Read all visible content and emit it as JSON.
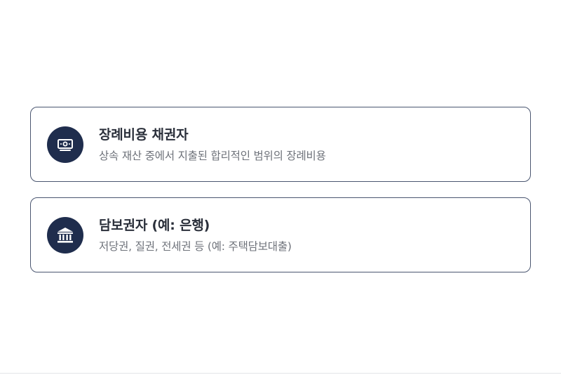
{
  "options": [
    {
      "icon": "cash-icon",
      "title": "장례비용 채권자",
      "description": "상속 재산 중에서 지출된 합리적인 범위의 장례비용"
    },
    {
      "icon": "bank-icon",
      "title": "담보권자 (예: 은행)",
      "description": "저당권, 질권, 전세권 등 (예: 주택담보대출)"
    }
  ],
  "colors": {
    "icon_background": "#1f2d4d",
    "card_border": "#4a5670",
    "title_text": "#2a2f3a",
    "description_text": "#6e727a"
  }
}
